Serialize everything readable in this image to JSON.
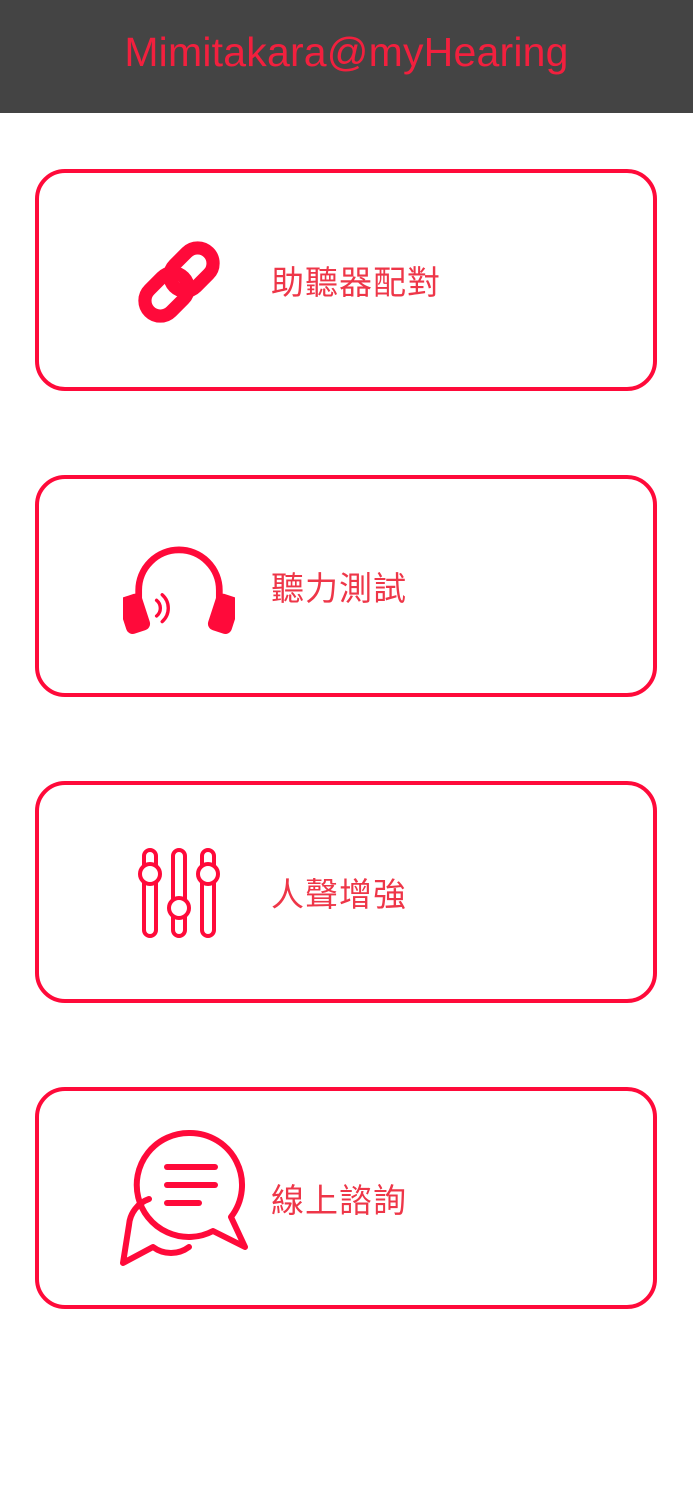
{
  "header": {
    "title": "Mimitakara@myHearing"
  },
  "menu": {
    "items": [
      {
        "label": "助聽器配對",
        "icon": "link-icon"
      },
      {
        "label": "聽力測試",
        "icon": "headphones-icon"
      },
      {
        "label": "人聲增強",
        "icon": "equalizer-sliders-icon"
      },
      {
        "label": "線上諮詢",
        "icon": "chat-bubbles-icon"
      }
    ]
  },
  "colors": {
    "header_bg": "#444444",
    "accent": "#ff0a3a",
    "label_text": "#ee3648",
    "background": "#ffffff"
  }
}
